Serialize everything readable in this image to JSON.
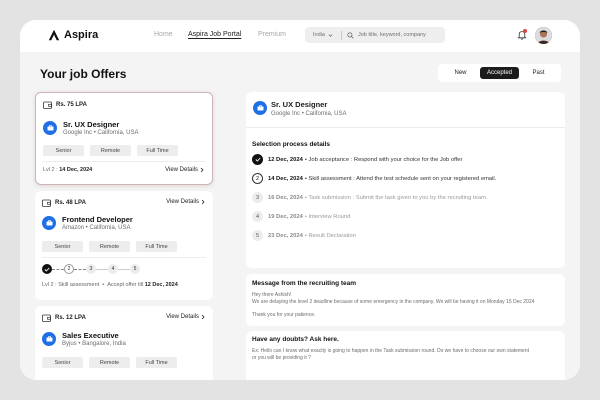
{
  "header": {
    "brand": "Aspira",
    "nav": [
      "Home",
      "Aspira Job Portal",
      "Premium"
    ],
    "active_nav": "Aspira Job Portal",
    "search": {
      "country": "India",
      "placeholder": "Job title, keyword, company"
    },
    "notification_badge": true
  },
  "page": {
    "title": "Your job Offers",
    "tabs": [
      "New",
      "Accepted",
      "Past"
    ],
    "active_tab": "Accepted"
  },
  "offers": [
    {
      "salary": "Rs. 75 LPA",
      "title": "Sr. UX Designer",
      "company": "Google Inc",
      "location": "California, USA",
      "tags": [
        "Senior",
        "Remote",
        "Full Time"
      ],
      "level_prefix": "Lvl 2 :",
      "level_date": "14 Dec, 2024",
      "view_details": "View Details",
      "selected": true
    },
    {
      "salary": "Rs. 48 LPA",
      "title": "Frontend Developer",
      "company": "Amazon",
      "location": "California, USA",
      "tags": [
        "Senior",
        "Remote",
        "Full Time"
      ],
      "view_details": "View Details",
      "steps": [
        "",
        "2",
        "3",
        "4",
        "5"
      ],
      "level_prefix": "Lvl 2 : Skill assessment",
      "level_mid": "Accept offer till",
      "level_date": "12 Dec, 2024"
    },
    {
      "salary": "Rs. 12 LPA",
      "title": "Sales Executive",
      "company": "Byjus",
      "location": "Bangalore, India",
      "tags": [
        "Senior",
        "Remote",
        "Full Time"
      ],
      "view_details": "View Details"
    }
  ],
  "detail": {
    "title": "Sr. UX Designer",
    "company": "Google Inc",
    "location": "California, USA",
    "section_title": "Selection process details",
    "process": [
      {
        "num": "",
        "date": "12 Dec, 2024",
        "text": "• Job acceptance : Respond with your choice for the Job offer",
        "state": "done"
      },
      {
        "num": "2",
        "date": "14 Dec, 2024",
        "text": "• Skill assessment : Attend the test schedule sent on your registered email.",
        "state": "current"
      },
      {
        "num": "3",
        "date": "16 Dec, 2024",
        "text": "• Task submission : Submit the task given to you by the recruiting team.",
        "state": "pending"
      },
      {
        "num": "4",
        "date": "19 Dec, 2024",
        "text": "• Interview Round",
        "state": "pending"
      },
      {
        "num": "5",
        "date": "23 Dec, 2024",
        "text": "• Result Declaration",
        "state": "pending"
      }
    ]
  },
  "message": {
    "title": "Message from the recruiting team",
    "lines": [
      "Hey there Ashish!",
      "We are delaying the level 2 deadline because of some emergency in the company. We will be having it on Monday 15 Dec 2024",
      "Thank you for your patience."
    ]
  },
  "ask": {
    "title": "Have any doubts? Ask here.",
    "lines": [
      "Ex: Hello can I know what exactly is going to happen in the Task submission round. Do we have to choose our own statement",
      "or you will be providing it ?"
    ]
  },
  "colors": {
    "accent_blue": "#1f6fe6",
    "dark": "#1c1c1c",
    "notification_red": "#e0433e"
  },
  "icons": {
    "logo": "aspira-logo-icon",
    "search": "search-icon",
    "notification": "bell-icon",
    "salary": "wallet-icon",
    "company": "briefcase-icon",
    "check": "check-icon",
    "chevron": "chevron-right-icon"
  }
}
